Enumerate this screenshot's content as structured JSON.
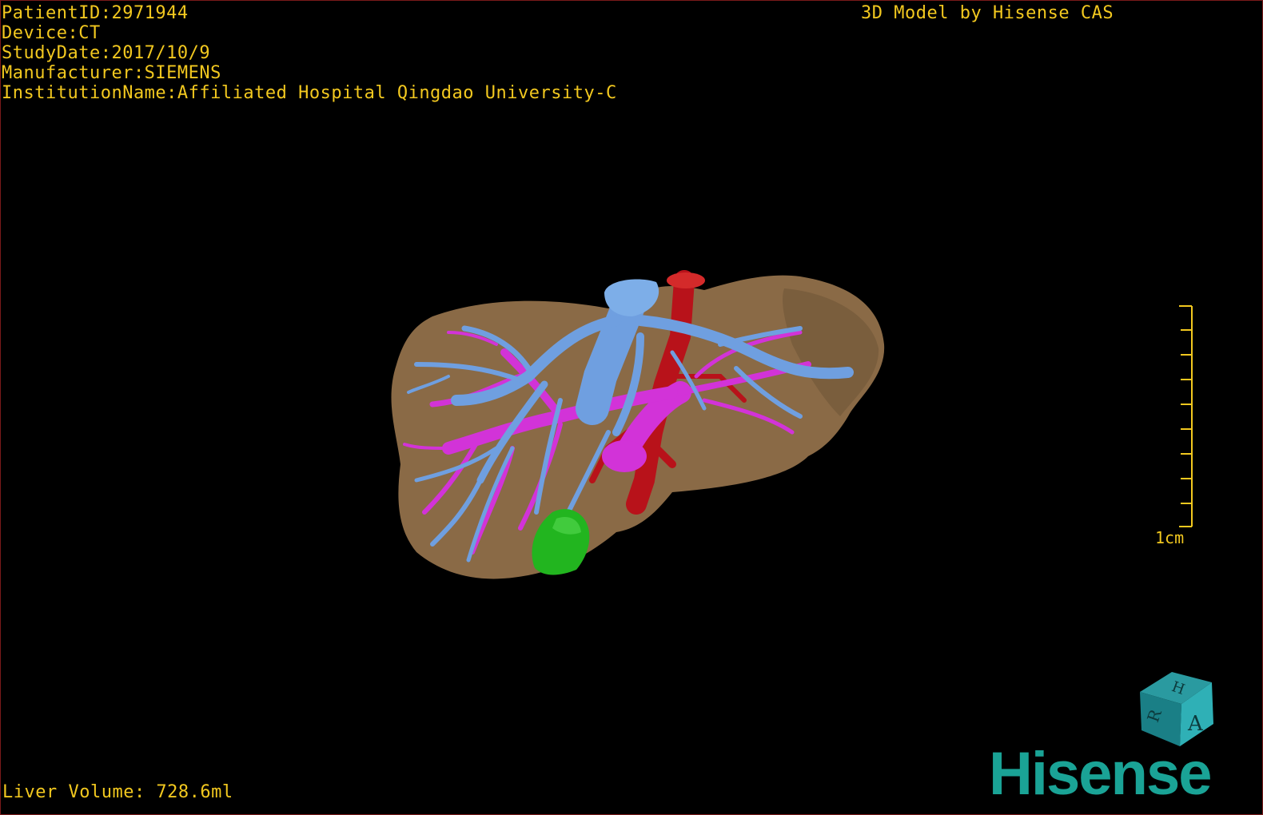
{
  "header": {
    "patient_id": "PatientID:2971944",
    "device": "Device:CT",
    "study_date": "StudyDate:2017/10/9",
    "manufacturer": "Manufacturer:SIEMENS",
    "institution": "InstitutionName:Affiliated Hospital Qingdao University-C",
    "credit": "3D Model by Hisense CAS"
  },
  "footer": {
    "liver_volume": "Liver Volume: 728.6ml"
  },
  "scale": {
    "label": "1cm"
  },
  "orientation_cube": {
    "labels": [
      "H",
      "R",
      "A"
    ]
  },
  "brand": {
    "logo_text": "Hisense"
  },
  "colors": {
    "overlay_text": "#f2c81f",
    "liver": "#8a6a46",
    "hepatic_vein": "#6f9fe0",
    "portal_vein": "#d233d8",
    "artery": "#b8121a",
    "lesion": "#22b51f",
    "brand": "#1aa396"
  }
}
